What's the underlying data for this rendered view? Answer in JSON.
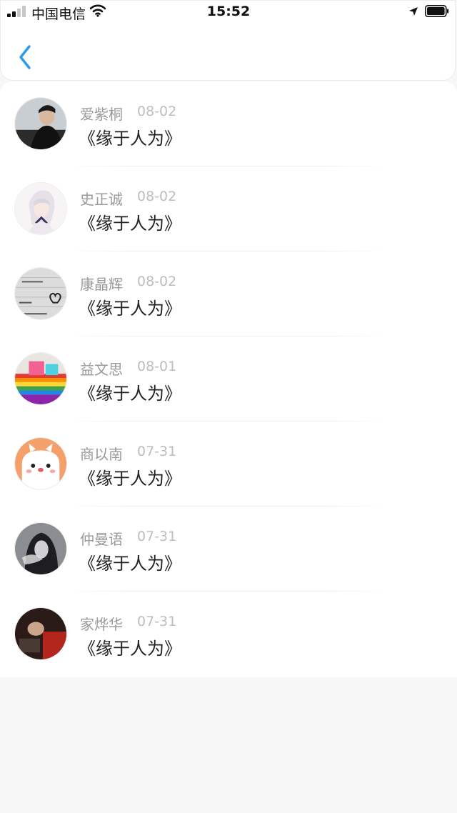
{
  "status_bar": {
    "carrier": "中国电信",
    "time": "15:52"
  },
  "header": {
    "back_icon": "chevron-left-icon",
    "accent_color": "#2e9be6"
  },
  "list": {
    "items": [
      {
        "name": "爱紫桐",
        "date": "08-02",
        "title": "《缘于人为》",
        "avatar": "photo-young-man-dark"
      },
      {
        "name": "史正诚",
        "date": "08-02",
        "title": "《缘于人为》",
        "avatar": "anime-girl-white-hair"
      },
      {
        "name": "康晶辉",
        "date": "08-02",
        "title": "《缘于人为》",
        "avatar": "handwritten-note-heart"
      },
      {
        "name": "益文思",
        "date": "08-01",
        "title": "《缘于人为》",
        "avatar": "rainbow-cakes"
      },
      {
        "name": "商以南",
        "date": "07-31",
        "title": "《缘于人为》",
        "avatar": "cartoon-white-puppy-orange"
      },
      {
        "name": "仲曼语",
        "date": "07-31",
        "title": "《缘于人为》",
        "avatar": "hooded-girl-smoke"
      },
      {
        "name": "家烨华",
        "date": "07-31",
        "title": "《缘于人为》",
        "avatar": "dark-red-photo"
      }
    ]
  }
}
